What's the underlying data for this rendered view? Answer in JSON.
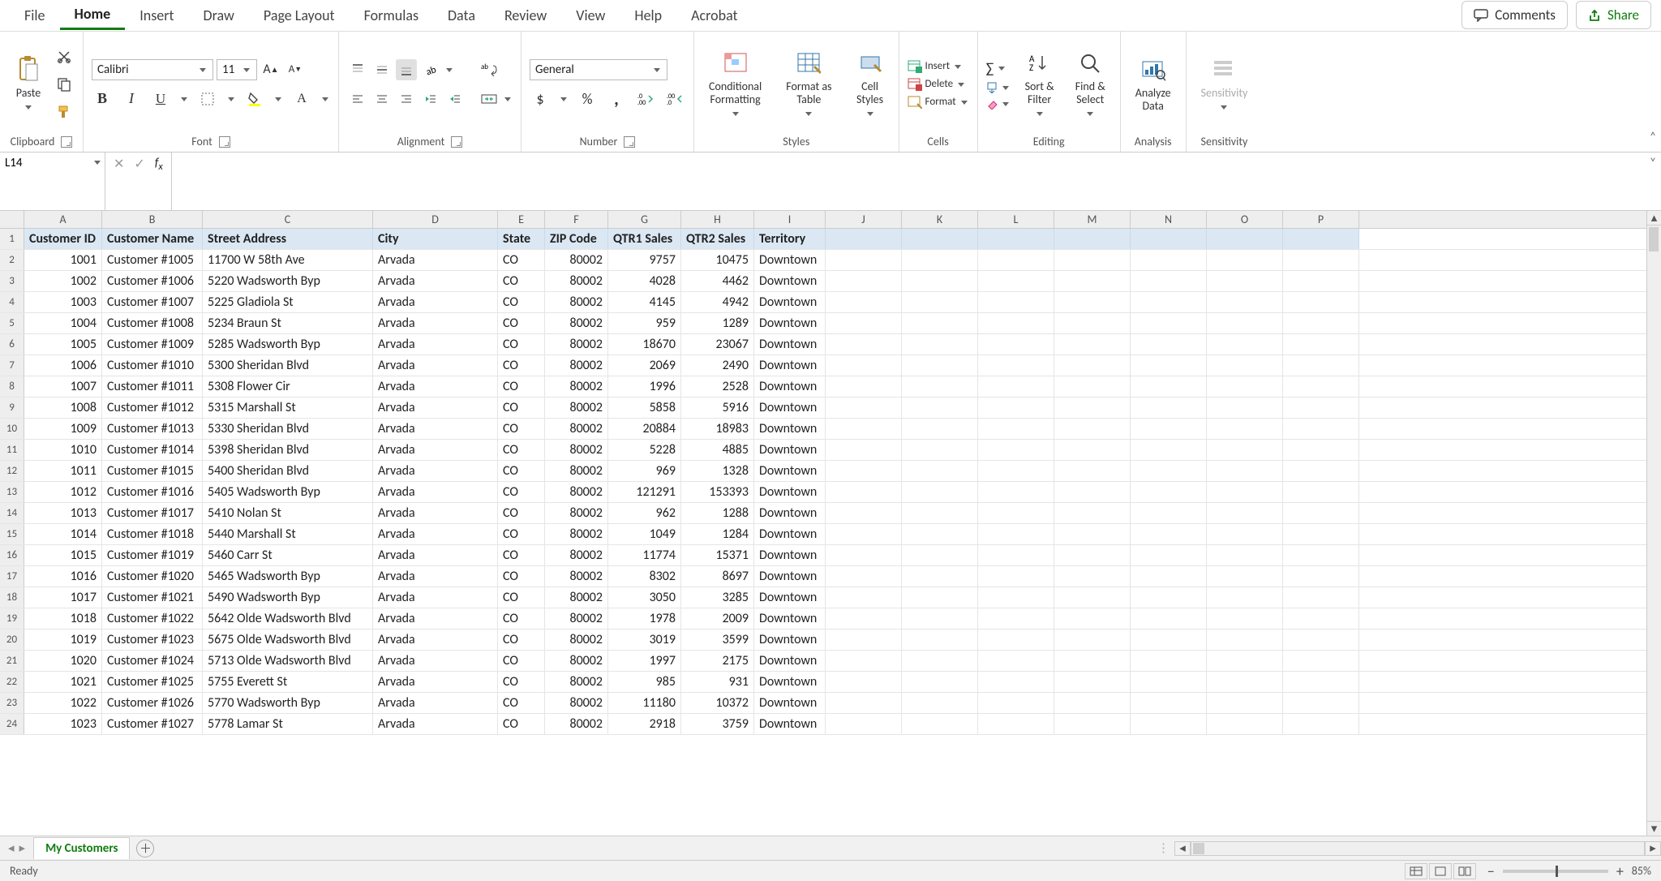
{
  "tabs": [
    "File",
    "Home",
    "Insert",
    "Draw",
    "Page Layout",
    "Formulas",
    "Data",
    "Review",
    "View",
    "Help",
    "Acrobat"
  ],
  "active_tab": "Home",
  "comments": "Comments",
  "share": "Share",
  "ribbon": {
    "clipboard": "Clipboard",
    "paste": "Paste",
    "font_group": "Font",
    "font_name": "Calibri",
    "font_size": "11",
    "alignment": "Alignment",
    "number": "Number",
    "number_format": "General",
    "styles": "Styles",
    "cond_fmt": "Conditional\nFormatting",
    "fmt_table": "Format as\nTable",
    "cell_styles": "Cell\nStyles",
    "cells": "Cells",
    "insert": "Insert",
    "delete": "Delete",
    "format": "Format",
    "editing": "Editing",
    "sort_filter": "Sort &\nFilter",
    "find_select": "Find &\nSelect",
    "analysis": "Analysis",
    "analyze_data": "Analyze\nData",
    "sensitivity": "Sensitivity",
    "sensitivity_btn": "Sensitivity"
  },
  "name_box": "L14",
  "formula": "",
  "columns": [
    "A",
    "B",
    "C",
    "D",
    "E",
    "F",
    "G",
    "H",
    "I",
    "J",
    "K",
    "L",
    "M",
    "N",
    "O",
    "P"
  ],
  "col_classes": [
    "cA",
    "cB",
    "cC",
    "cD",
    "cE",
    "cF",
    "cG",
    "cH",
    "cI",
    "cJ",
    "cK",
    "cL",
    "cM",
    "cN",
    "cO",
    "cP"
  ],
  "headers": [
    "Customer ID",
    "Customer Name",
    "Street Address",
    "City",
    "State",
    "ZIP Code",
    "QTR1 Sales",
    "QTR2 Sales",
    "Territory"
  ],
  "num_cols": [
    0,
    5,
    6,
    7
  ],
  "rows": [
    [
      1001,
      "Customer #1005",
      "11700 W 58th Ave",
      "Arvada",
      "CO",
      80002,
      9757,
      10475,
      "Downtown"
    ],
    [
      1002,
      "Customer #1006",
      "5220 Wadsworth Byp",
      "Arvada",
      "CO",
      80002,
      4028,
      4462,
      "Downtown"
    ],
    [
      1003,
      "Customer #1007",
      "5225 Gladiola St",
      "Arvada",
      "CO",
      80002,
      4145,
      4942,
      "Downtown"
    ],
    [
      1004,
      "Customer #1008",
      "5234 Braun St",
      "Arvada",
      "CO",
      80002,
      959,
      1289,
      "Downtown"
    ],
    [
      1005,
      "Customer #1009",
      "5285 Wadsworth Byp",
      "Arvada",
      "CO",
      80002,
      18670,
      23067,
      "Downtown"
    ],
    [
      1006,
      "Customer #1010",
      "5300 Sheridan Blvd",
      "Arvada",
      "CO",
      80002,
      2069,
      2490,
      "Downtown"
    ],
    [
      1007,
      "Customer #1011",
      "5308 Flower Cir",
      "Arvada",
      "CO",
      80002,
      1996,
      2528,
      "Downtown"
    ],
    [
      1008,
      "Customer #1012",
      "5315 Marshall St",
      "Arvada",
      "CO",
      80002,
      5858,
      5916,
      "Downtown"
    ],
    [
      1009,
      "Customer #1013",
      "5330 Sheridan Blvd",
      "Arvada",
      "CO",
      80002,
      20884,
      18983,
      "Downtown"
    ],
    [
      1010,
      "Customer #1014",
      "5398 Sheridan Blvd",
      "Arvada",
      "CO",
      80002,
      5228,
      4885,
      "Downtown"
    ],
    [
      1011,
      "Customer #1015",
      "5400 Sheridan Blvd",
      "Arvada",
      "CO",
      80002,
      969,
      1328,
      "Downtown"
    ],
    [
      1012,
      "Customer #1016",
      "5405 Wadsworth Byp",
      "Arvada",
      "CO",
      80002,
      121291,
      153393,
      "Downtown"
    ],
    [
      1013,
      "Customer #1017",
      "5410 Nolan St",
      "Arvada",
      "CO",
      80002,
      962,
      1288,
      "Downtown"
    ],
    [
      1014,
      "Customer #1018",
      "5440 Marshall St",
      "Arvada",
      "CO",
      80002,
      1049,
      1284,
      "Downtown"
    ],
    [
      1015,
      "Customer #1019",
      "5460 Carr St",
      "Arvada",
      "CO",
      80002,
      11774,
      15371,
      "Downtown"
    ],
    [
      1016,
      "Customer #1020",
      "5465 Wadsworth Byp",
      "Arvada",
      "CO",
      80002,
      8302,
      8697,
      "Downtown"
    ],
    [
      1017,
      "Customer #1021",
      "5490 Wadsworth Byp",
      "Arvada",
      "CO",
      80002,
      3050,
      3285,
      "Downtown"
    ],
    [
      1018,
      "Customer #1022",
      "5642 Olde Wadsworth Blvd",
      "Arvada",
      "CO",
      80002,
      1978,
      2009,
      "Downtown"
    ],
    [
      1019,
      "Customer #1023",
      "5675 Olde Wadsworth Blvd",
      "Arvada",
      "CO",
      80002,
      3019,
      3599,
      "Downtown"
    ],
    [
      1020,
      "Customer #1024",
      "5713 Olde Wadsworth Blvd",
      "Arvada",
      "CO",
      80002,
      1997,
      2175,
      "Downtown"
    ],
    [
      1021,
      "Customer #1025",
      "5755 Everett St",
      "Arvada",
      "CO",
      80002,
      985,
      931,
      "Downtown"
    ],
    [
      1022,
      "Customer #1026",
      "5770 Wadsworth Byp",
      "Arvada",
      "CO",
      80002,
      11180,
      10372,
      "Downtown"
    ],
    [
      1023,
      "Customer #1027",
      "5778 Lamar St",
      "Arvada",
      "CO",
      80002,
      2918,
      3759,
      "Downtown"
    ]
  ],
  "sheet_tab": "My Customers",
  "status": "Ready",
  "zoom": "85%"
}
